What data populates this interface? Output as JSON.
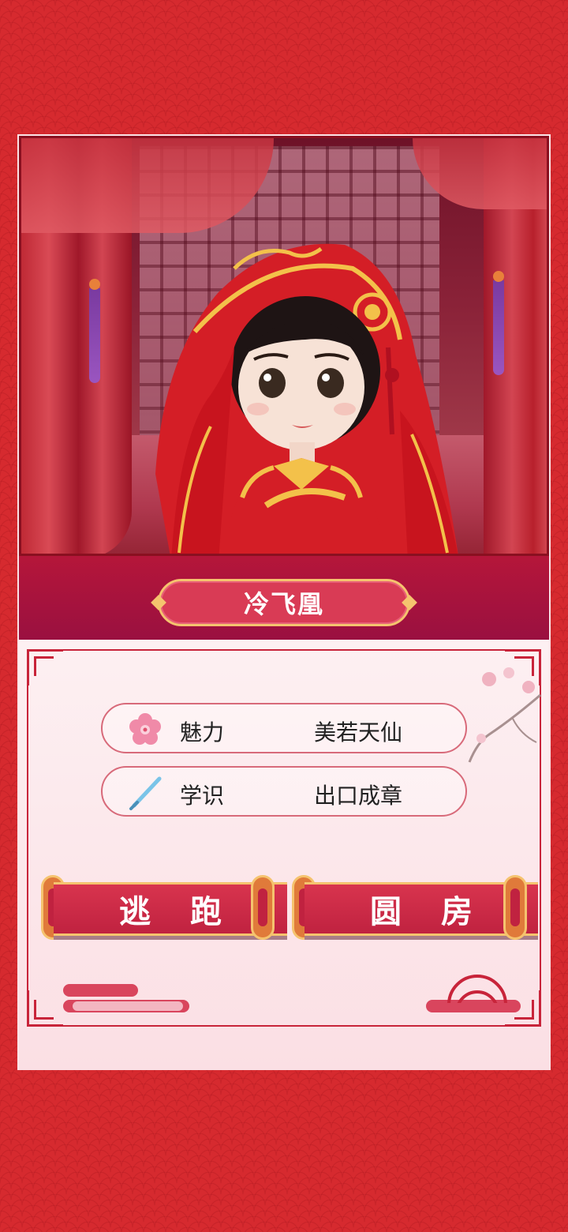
{
  "character": {
    "name": "冷飞凰"
  },
  "stats": [
    {
      "icon": "plum-blossom-icon",
      "label": "魅力",
      "value": "美若天仙"
    },
    {
      "icon": "brush-icon",
      "label": "学识",
      "value": "出口成章"
    }
  ],
  "actions": {
    "escape_label": "逃 跑",
    "consummate_label": "圆 房"
  },
  "colors": {
    "background_red": "#d62a2f",
    "band_crimson": "#b5163a",
    "button_red": "#c8243a",
    "gold_trim": "#f5c36e",
    "panel_pink": "#fbe3e6"
  }
}
